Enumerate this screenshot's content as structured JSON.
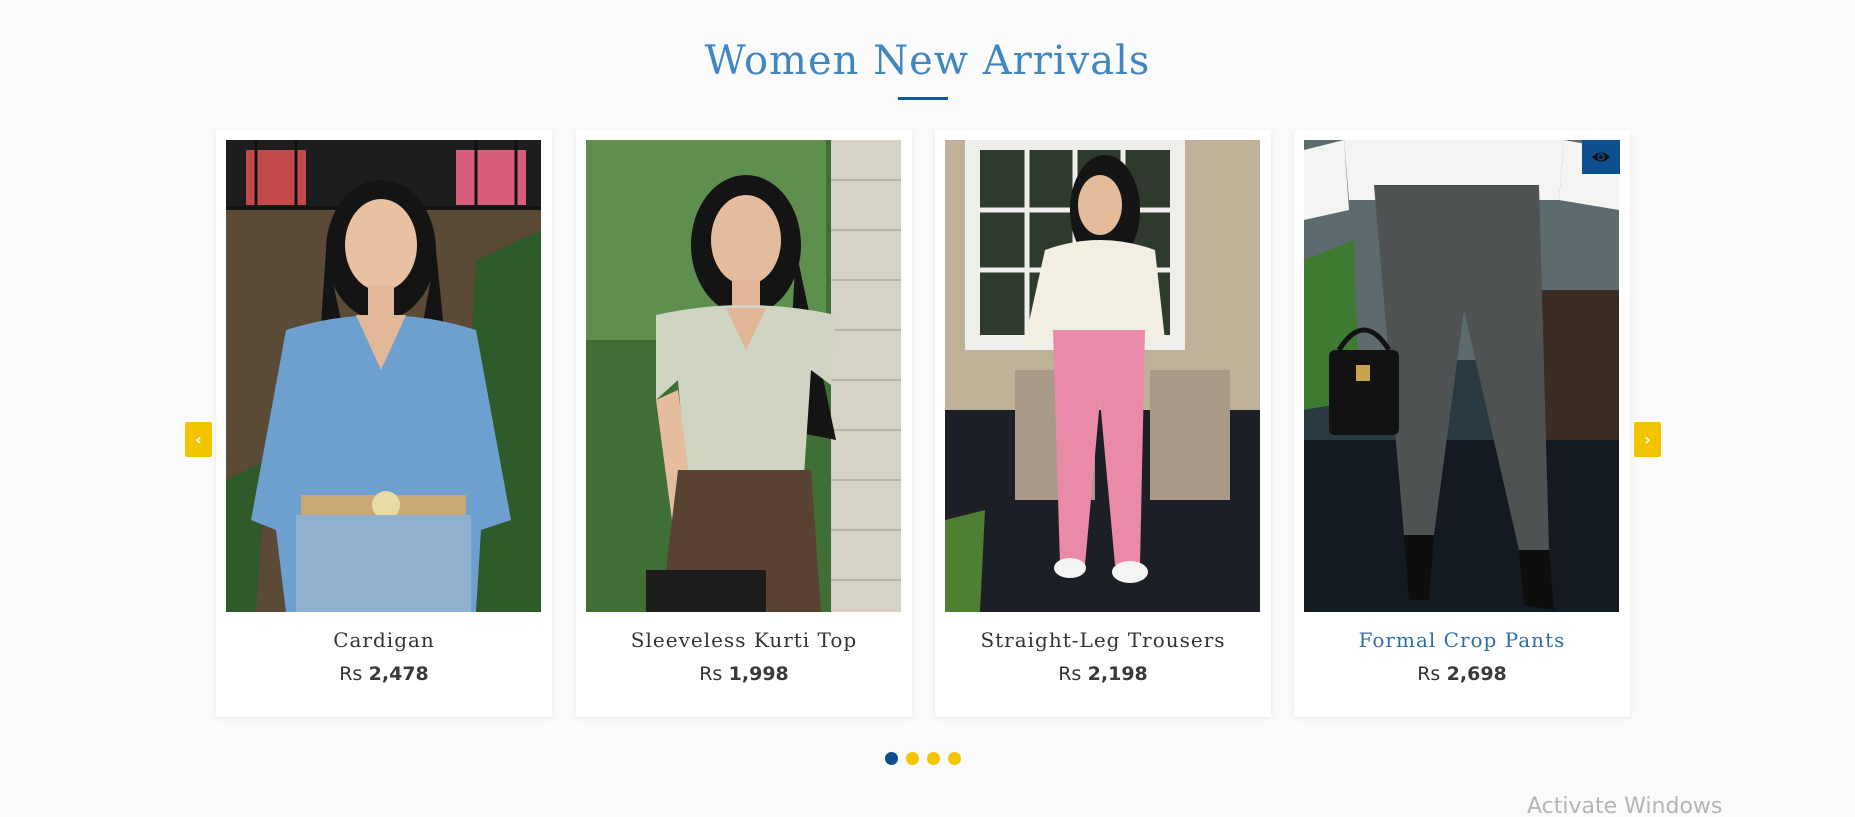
{
  "section": {
    "title": "Women New Arrivals"
  },
  "products": [
    {
      "name": "Cardigan",
      "currency": "Rs",
      "price": "2,478"
    },
    {
      "name": "Sleeveless Kurti Top",
      "currency": "Rs",
      "price": "1,998"
    },
    {
      "name": "Straight-Leg Trousers",
      "currency": "Rs",
      "price": "2,198"
    },
    {
      "name": "Formal Crop Pants",
      "currency": "Rs",
      "price": "2,698"
    }
  ],
  "carousel": {
    "prev_icon": "chevron-left-icon",
    "next_icon": "chevron-right-icon",
    "pages": 4,
    "active_page": 1
  },
  "quick_view": {
    "icon": "eye-icon"
  },
  "colors": {
    "accent": "#3f86c2",
    "brand_blue": "#0d4f8f",
    "button_yellow": "#f2c400",
    "background": "#fbfbfb"
  },
  "watermark": {
    "text": "Activate Windows"
  }
}
